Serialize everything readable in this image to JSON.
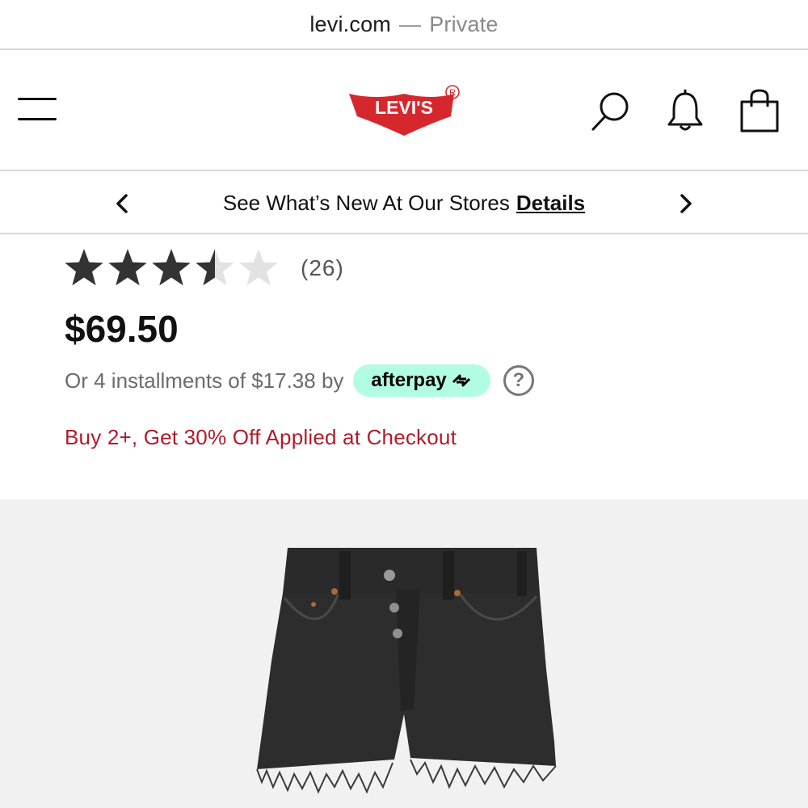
{
  "browser": {
    "domain": "levi.com",
    "separator": "—",
    "mode": "Private"
  },
  "header": {
    "logo_text": "LEVI'S",
    "icons": [
      "menu-icon",
      "search-icon",
      "bell-icon",
      "bag-icon"
    ],
    "brand_color": "#d7272e"
  },
  "promo": {
    "text": "See What’s New At Our Stores",
    "link": "Details"
  },
  "product": {
    "rating": {
      "value": 3.5,
      "max": 5,
      "count_text": "(26)"
    },
    "price": "$69.50",
    "installments": {
      "text": "Or 4 installments of $17.38 by",
      "provider": "afterpay",
      "help": "?"
    },
    "offer": "Buy 2+, Get 30% Off Applied at Checkout",
    "image_alt": "black denim shorts"
  },
  "colors": {
    "offer_red": "#b11c2b",
    "afterpay_mint": "#b2fce4",
    "star_filled": "#333333",
    "star_empty": "#e2e2e2"
  }
}
